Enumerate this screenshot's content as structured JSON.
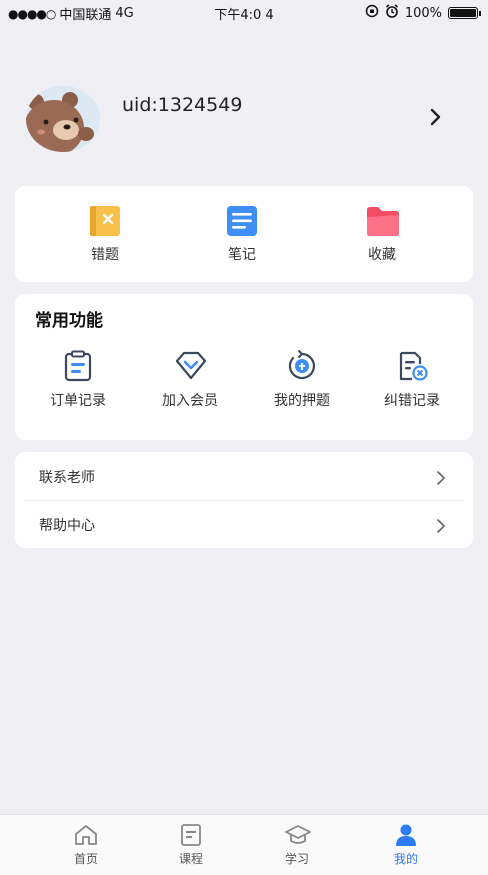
{
  "status_bar": {
    "signal": "●●●●○",
    "carrier": "中国联通",
    "network": "4G",
    "time": "下午4:0 4",
    "battery": "100%"
  },
  "profile": {
    "uid_text": "uid:1324549"
  },
  "quick_actions": [
    {
      "label": "错题",
      "icon": "wrong-questions-icon"
    },
    {
      "label": "笔记",
      "icon": "notes-icon"
    },
    {
      "label": "收藏",
      "icon": "favorites-folder-icon"
    }
  ],
  "functions": {
    "title": "常用功能",
    "items": [
      {
        "label": "订单记录",
        "icon": "order-clipboard-icon"
      },
      {
        "label": "加入会员",
        "icon": "diamond-icon"
      },
      {
        "label": "我的押题",
        "icon": "bet-question-icon"
      },
      {
        "label": "纠错记录",
        "icon": "error-report-icon"
      }
    ]
  },
  "menu": [
    {
      "label": "联系老师"
    },
    {
      "label": "帮助中心"
    }
  ],
  "tabs": [
    {
      "label": "首页",
      "icon": "home-icon"
    },
    {
      "label": "课程",
      "icon": "course-icon"
    },
    {
      "label": "学习",
      "icon": "graduation-cap-icon"
    },
    {
      "label": "我的",
      "icon": "user-icon",
      "active": true
    }
  ],
  "colors": {
    "accent": "#2d7cf6",
    "background": "#efeff4",
    "card": "#ffffff"
  }
}
